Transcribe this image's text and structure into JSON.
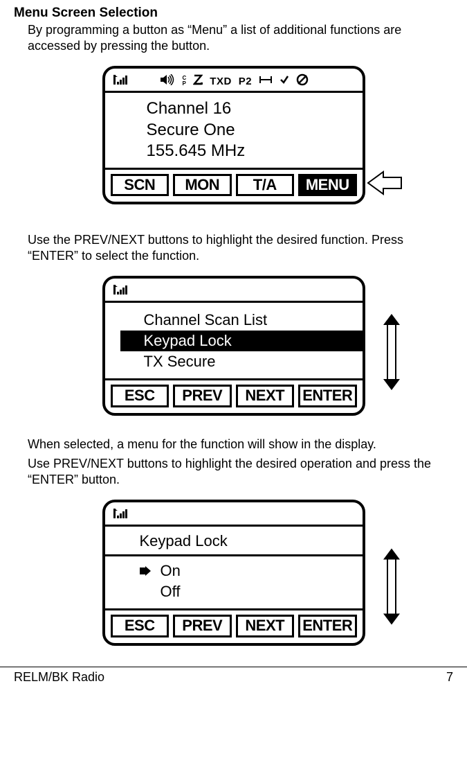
{
  "heading": "Menu Screen Selection",
  "para1": "By programming a button as “Menu” a list of additional functions are accessed by pressing the button.",
  "para2": "Use the PREV/NEXT buttons to highlight the desired function. Press “ENTER” to select the function.",
  "para3": "When selected, a menu for the function will show in the display.",
  "para4": "Use PREV/NEXT buttons to highlight the desired operation and press the “ENTER” button.",
  "screen1": {
    "status": {
      "cp_top": "C",
      "cp_bot": "P",
      "txd": "TXD",
      "p2": "P2"
    },
    "line1": "Channel 16",
    "line2": "Secure One",
    "line3": "155.645 MHz",
    "softkeys": {
      "k1": "SCN",
      "k2": "MON",
      "k3": "T/A",
      "k4": "MENU"
    }
  },
  "screen2": {
    "items": {
      "i1": "Channel Scan List",
      "i2": "Keypad Lock",
      "i3": "TX Secure"
    },
    "softkeys": {
      "k1": "ESC",
      "k2": "PREV",
      "k3": "NEXT",
      "k4": "ENTER"
    }
  },
  "screen3": {
    "title": "Keypad Lock",
    "opt1": "On",
    "opt2": "Off",
    "softkeys": {
      "k1": "ESC",
      "k2": "PREV",
      "k3": "NEXT",
      "k4": "ENTER"
    }
  },
  "footer": {
    "left": "RELM/BK Radio",
    "right": "7"
  }
}
